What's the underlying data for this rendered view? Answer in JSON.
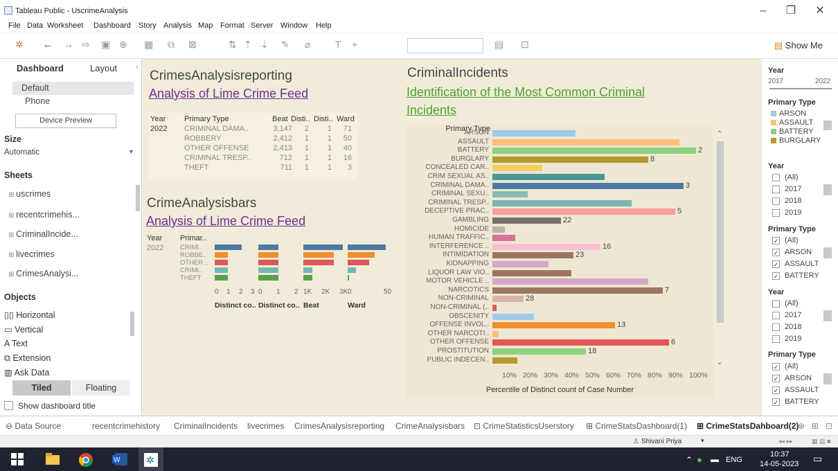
{
  "window": {
    "title": "Tableau Public - UscrimeAnalysis",
    "min": "–",
    "max": "❐",
    "close": "✕"
  },
  "menu": [
    "File",
    "Data",
    "Worksheet",
    "Dashboard",
    "Story",
    "Analysis",
    "Map",
    "Format",
    "Server",
    "Window",
    "Help"
  ],
  "toolbar": {
    "show_me": "Show Me"
  },
  "left_panel": {
    "tabs": [
      "Dashboard",
      "Layout"
    ],
    "device_options": [
      "Default",
      "Phone"
    ],
    "device_preview": "Device Preview",
    "size_header": "Size",
    "size_value": "Automatic",
    "sheets_header": "Sheets",
    "sheets": [
      "uscrimes",
      "recentcrimehis...",
      "CriminalIncide...",
      "livecrimes",
      "CrimesAnalysi..."
    ],
    "objects_header": "Objects",
    "objects": [
      "Horizontal",
      "Vertical",
      "Text",
      "Extension",
      "Ask Data"
    ],
    "tiled": "Tiled",
    "floating": "Floating",
    "show_title": "Show dashboard title"
  },
  "reporting": {
    "title": "CrimesAnalysisreporting",
    "subtitle": "Analysis of Lime Crime Feed",
    "headers": [
      "Year",
      "Primary Type",
      "Beat",
      "Disti..",
      "Disti..",
      "Ward"
    ],
    "year": "2022",
    "rows": [
      [
        "CRIMINAL DAMA..",
        "3,147",
        "2",
        "1",
        "71"
      ],
      [
        "ROBBERY",
        "2,412",
        "1",
        "1",
        "50"
      ],
      [
        "OTHER OFFENSE",
        "2,413",
        "1",
        "1",
        "40"
      ],
      [
        "CRIMINAL TRESP..",
        "712",
        "1",
        "1",
        "16"
      ],
      [
        "THEFT",
        "711",
        "1",
        "1",
        "3"
      ]
    ]
  },
  "bars_sheet": {
    "title": "CrimeAnalysisbars",
    "subtitle": "Analysis of Lime Crime Feed",
    "headers": [
      "Year",
      "Primar.."
    ],
    "year": "2022",
    "rows": [
      "CRIMI..",
      "ROBBE..",
      "OTHER ..",
      "CRIMI..",
      "THEFT"
    ],
    "colors": [
      "#4e79a7",
      "#f28e2b",
      "#e15759",
      "#76b7b2",
      "#59a14f"
    ],
    "panels": [
      {
        "label": "Distinct co..",
        "ticks": [
          "0",
          "1",
          "2",
          "3"
        ],
        "values": [
          2,
          1,
          1,
          1,
          1
        ],
        "max": 3
      },
      {
        "label": "Distinct co..",
        "ticks": [
          "0",
          "1",
          "2"
        ],
        "values": [
          1,
          1,
          1,
          1,
          1
        ],
        "max": 2
      },
      {
        "label": "Beat",
        "ticks": [
          "1K",
          "2K",
          "3K"
        ],
        "values": [
          3147,
          2412,
          2413,
          712,
          711
        ],
        "max": 3200
      },
      {
        "label": "Ward",
        "ticks": [
          "0",
          "50"
        ],
        "values": [
          71,
          50,
          40,
          16,
          3
        ],
        "max": 75
      }
    ]
  },
  "incidents": {
    "title": "CriminalIncidents",
    "subtitle_line1": "Identification of the Most Common Criminal",
    "subtitle_line2": "Incidents",
    "axis_header": "Primary Type",
    "xlabel": "Percentile of Distinct count of Case Number",
    "xticks": [
      "10%",
      "20%",
      "30%",
      "40%",
      "50%",
      "60%",
      "70%",
      "80%",
      "90%",
      "100%"
    ]
  },
  "chart_data": {
    "type": "bar",
    "orientation": "horizontal",
    "ylabel": "Primary Type",
    "xlabel": "Percentile of Distinct count of Case Number",
    "xlim": [
      0,
      100
    ],
    "categories": [
      "ARSON",
      "ASSAULT",
      "BATTERY",
      "BURGLARY",
      "CONCEALED CAR..",
      "CRIM SEXUAL AS..",
      "CRIMINAL DAMA..",
      "CRIMINAL SEXU..",
      "CRIMINAL TRESP..",
      "DECEPTIVE PRAC..",
      "GAMBLING",
      "HOMICIDE",
      "HUMAN TRAFFIC..",
      "INTERFERENCE ..",
      "INTIMIDATION",
      "KIDNAPPING",
      "LIQUOR LAW VIO..",
      "MOTOR VEHICLE ..",
      "NARCOTICS",
      "NON-CRIMINAL",
      "NON-CRIMINAL (..",
      "OBSCENITY",
      "OFFENSE INVOL..",
      "OTHER NARCOTI..",
      "OTHER OFFENSE",
      "PROSTITUTION",
      "PUBLIC INDECEN.."
    ],
    "values": [
      40,
      90,
      98,
      75,
      24,
      54,
      92,
      17,
      67,
      88,
      33,
      6,
      11,
      52,
      39,
      27,
      38,
      75,
      82,
      15,
      2,
      20,
      59,
      3,
      85,
      45,
      12
    ],
    "rank_labels": [
      "",
      "",
      "2",
      "8",
      "",
      "",
      "3",
      "",
      "",
      "5",
      "22",
      "",
      "",
      "16",
      "23",
      "",
      "",
      "",
      "7",
      "28",
      "",
      "",
      "13",
      "",
      "6",
      "18",
      ""
    ],
    "colors": [
      "#a0cbe8",
      "#ffbe7d",
      "#8cd17d",
      "#b6992d",
      "#f1ce63",
      "#499894",
      "#4e79a7",
      "#86bcb6",
      "#79b7b2",
      "#ff9d9a",
      "#79706e",
      "#bab0ac",
      "#d37295",
      "#fabfd2",
      "#9d7660",
      "#d4a6c8",
      "#9d7660",
      "#d4a6c8",
      "#9d7660",
      "#d7b5a6",
      "#e15759",
      "#a0cbe8",
      "#f28e2b",
      "#ffbe7d",
      "#e15759",
      "#8cd17d",
      "#b6992d"
    ]
  },
  "right_panel": {
    "year_hdr": "Year",
    "year_min": "2017",
    "year_max": "2022",
    "ptype_hdr": "Primary Type",
    "legend": [
      {
        "label": "ARSON",
        "color": "#a0cbe8"
      },
      {
        "label": "ASSAULT",
        "color": "#ffbe7d"
      },
      {
        "label": "BATTERY",
        "color": "#8cd17d"
      },
      {
        "label": "BURGLARY",
        "color": "#b6992d"
      }
    ],
    "year_list": [
      "(All)",
      "2017",
      "2018",
      "2019"
    ],
    "ptype_list": [
      "(All)",
      "ARSON",
      "ASSAULT",
      "BATTERY"
    ]
  },
  "sheet_tabs": [
    "Data Source",
    "recentcrimehistory",
    "CriminalIncidents",
    "livecrimes",
    "CrimesAnalysisreporting",
    "CrimeAnalysisbars",
    "CrimeStatisticsUserstory",
    "CrimeStatsDashboard(1)",
    "CrimeStatsDahboard(2)"
  ],
  "status": {
    "user": "Shivani Priya"
  },
  "taskbar": {
    "lang": "ENG",
    "time": "10:37",
    "date": "14-05-2023"
  }
}
